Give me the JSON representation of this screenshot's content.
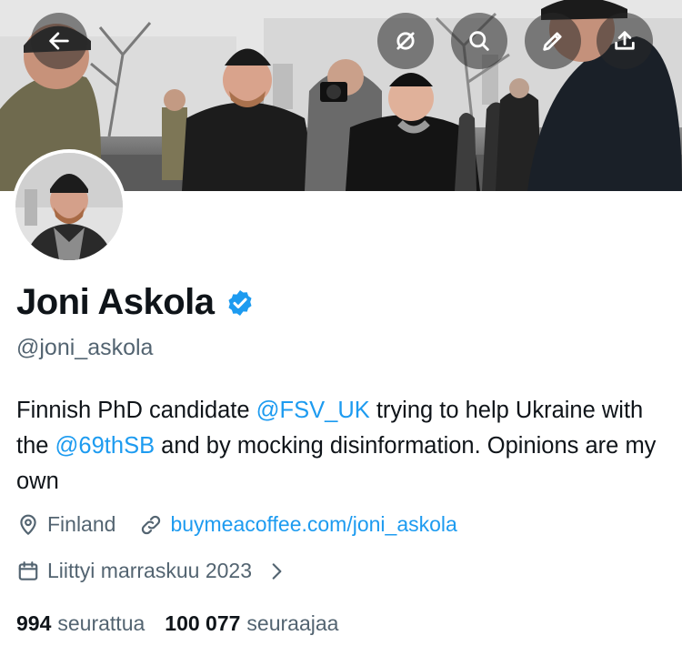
{
  "header": {
    "back_icon": "arrow-left-icon",
    "actions": [
      "grok-icon",
      "search-icon",
      "edit-icon",
      "share-icon"
    ]
  },
  "profile": {
    "display_name": "Joni Askola",
    "verified": true,
    "handle": "@joni_askola",
    "bio": {
      "part1": "Finnish PhD candidate ",
      "mention1": "@FSV_UK",
      "part2": " trying to help Ukraine with the ",
      "mention2": "@69thSB",
      "part3": " and by mocking disinformation. Opinions are my own"
    },
    "location": "Finland",
    "website": "buymeacoffee.com/joni_askola",
    "joined": "Liittyi marraskuu 2023"
  },
  "stats": {
    "following_count": "994",
    "following_label": "seurattua",
    "followers_count": "100 077",
    "followers_label": "seuraajaa"
  },
  "colors": {
    "accent": "#1d9bf0",
    "text_primary": "#0f1419",
    "text_secondary": "#536471"
  }
}
